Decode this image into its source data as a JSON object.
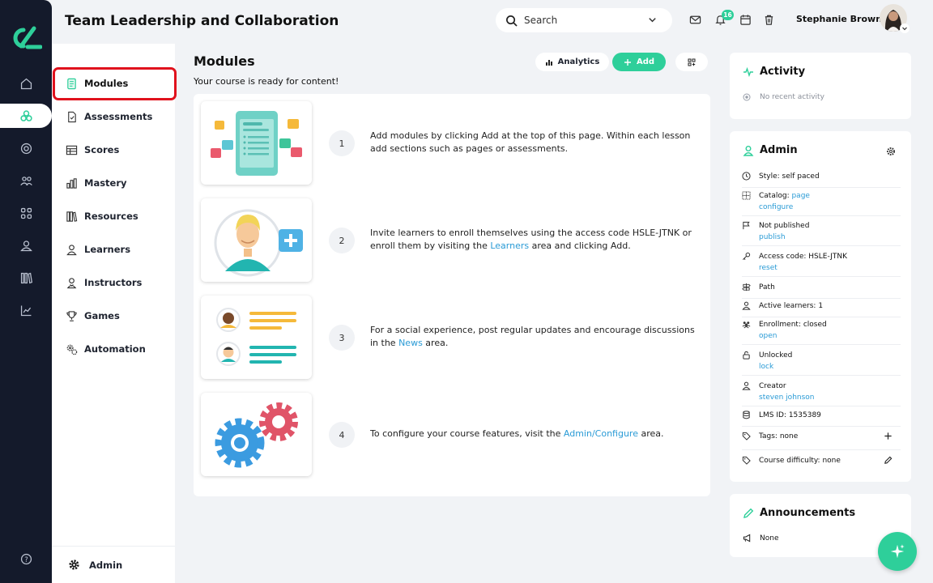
{
  "header": {
    "title": "Team Leadership and Collaboration",
    "search_placeholder": "Search",
    "notification_count": "16",
    "user_name": "Stephanie Brown"
  },
  "sidebar": {
    "items": [
      {
        "label": "Modules",
        "icon": "document-icon"
      },
      {
        "label": "Assessments",
        "icon": "file-check-icon"
      },
      {
        "label": "Scores",
        "icon": "table-icon"
      },
      {
        "label": "Mastery",
        "icon": "bar-chart-icon"
      },
      {
        "label": "Resources",
        "icon": "books-icon"
      },
      {
        "label": "Learners",
        "icon": "person-icon"
      },
      {
        "label": "Instructors",
        "icon": "instructor-icon"
      },
      {
        "label": "Games",
        "icon": "trophy-icon"
      },
      {
        "label": "Automation",
        "icon": "gears-icon"
      }
    ],
    "footer_label": "Admin"
  },
  "main": {
    "title": "Modules",
    "subtitle": "Your course is ready for content!",
    "analytics_label": "Analytics",
    "add_label": "Add",
    "steps": [
      {
        "num": "1",
        "text": "Add modules by clicking Add at the top of this page. Within each lesson add sections such as pages or assessments."
      },
      {
        "num": "2",
        "text_a": "Invite learners to enroll themselves using the access code HSLE-JTNK or enroll them by visiting the ",
        "link": "Learners",
        "text_b": " area and clicking Add."
      },
      {
        "num": "3",
        "text_a": "For a social experience, post regular updates and encourage discussions in the ",
        "link": "News",
        "text_b": " area."
      },
      {
        "num": "4",
        "text_a": "To configure your course features, visit the ",
        "link": "Admin/Configure",
        "text_b": " area."
      }
    ]
  },
  "activity": {
    "title": "Activity",
    "empty": "No recent activity"
  },
  "admin": {
    "title": "Admin",
    "rows": [
      {
        "label": "Style: self paced"
      },
      {
        "label": "Catalog: ",
        "inline_link": "page",
        "link": "configure"
      },
      {
        "label": "Not published",
        "link": "publish"
      },
      {
        "label": "Access code: HSLE-JTNK",
        "link": "reset"
      },
      {
        "label": "Path"
      },
      {
        "label": "Active learners: 1"
      },
      {
        "label": "Enrollment: closed",
        "link": "open"
      },
      {
        "label": "Unlocked",
        "link": "lock"
      },
      {
        "label": "Creator",
        "link": "steven johnson"
      },
      {
        "label": "LMS ID: 1535389"
      },
      {
        "label": "Tags: none"
      },
      {
        "label": "Course difficulty: none"
      }
    ]
  },
  "announcements": {
    "title": "Announcements",
    "body": "None"
  },
  "colors": {
    "accent": "#2ecf9a",
    "rail": "#141a2b",
    "link": "#2a9bd6",
    "highlight": "#e0121d"
  }
}
